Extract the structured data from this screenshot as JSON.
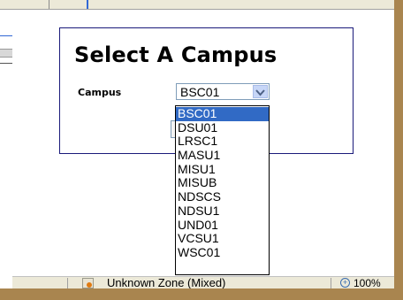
{
  "panel": {
    "title": "Select A Campus",
    "campus_label": "Campus"
  },
  "campus_select": {
    "value": "BSC01",
    "options": [
      "BSC01",
      "DSU01",
      "LRSC1",
      "MASU1",
      "MISU1",
      "MISUB",
      "NDSCS",
      "NDSU1",
      "UND01",
      "VCSU1",
      "WSC01"
    ],
    "highlighted": "BSC01"
  },
  "statusbar": {
    "zone_text": "Unknown Zone (Mixed)",
    "zoom": "100%"
  },
  "icons": {
    "dropdown_arrow": "chevron-down-icon",
    "zone": "zone-icon",
    "zoom": "zoom-icon"
  },
  "colors": {
    "selection": "#316ac5",
    "panel_border": "#1a1a7a",
    "desktop_bg": "#b8935a"
  }
}
